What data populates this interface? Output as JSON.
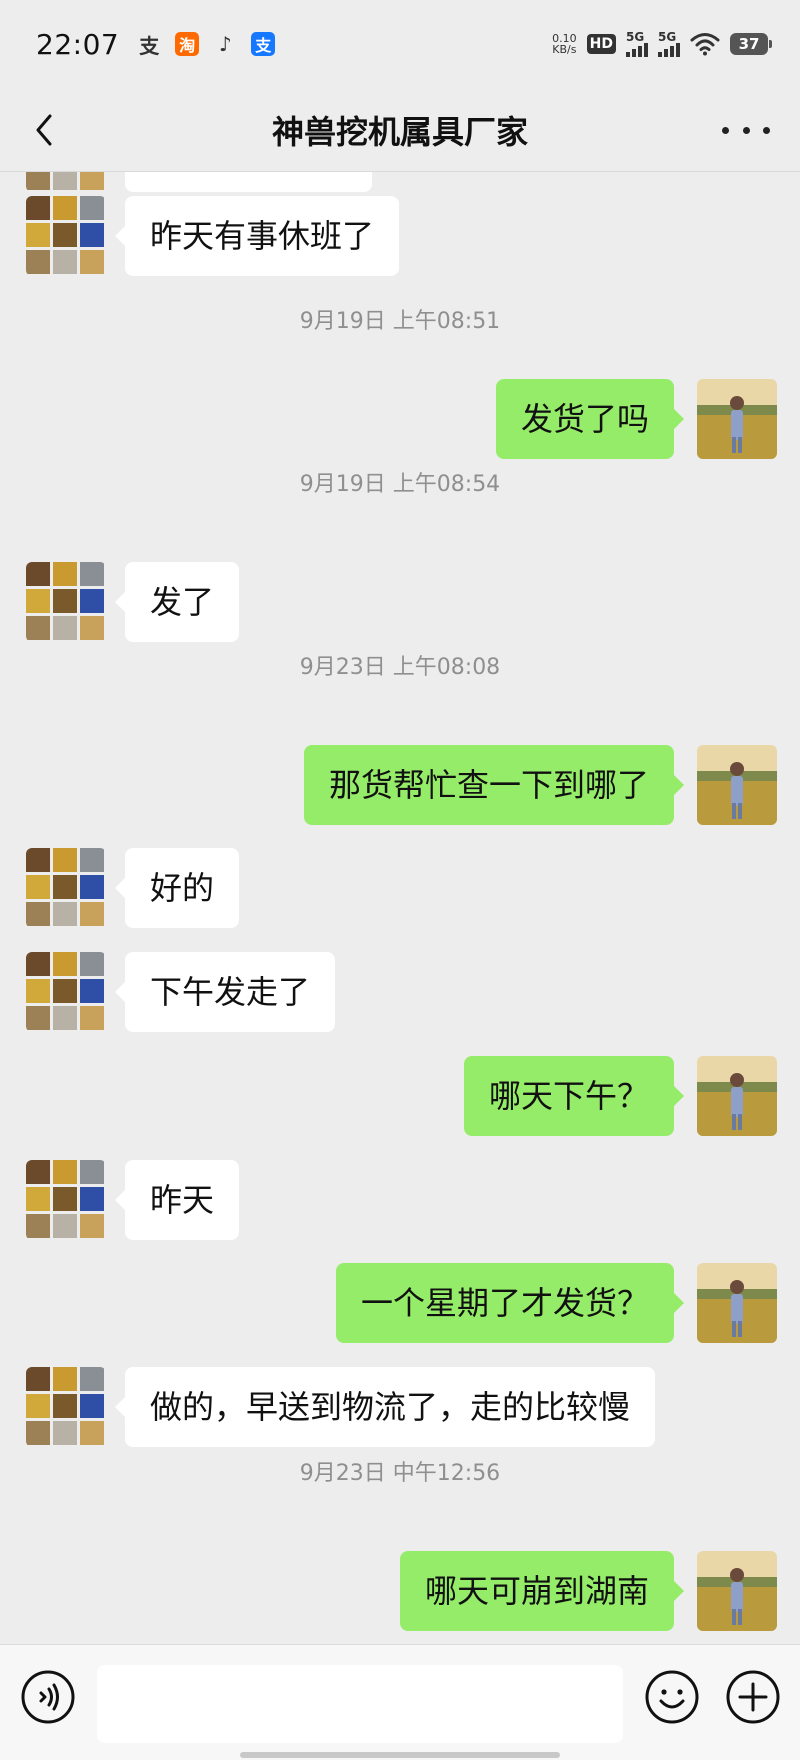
{
  "status_bar": {
    "time": "22:07",
    "net_speed_value": "0.10",
    "net_speed_unit": "KB/s",
    "hd_label": "HD",
    "signal1_label": "5G",
    "signal2_label": "5G",
    "battery": "37",
    "app_icons": [
      "alipay-icon",
      "taobao-icon",
      "tiktok-icon",
      "alipay-blue-icon"
    ],
    "app_glyphs": [
      "支",
      "淘",
      "♪",
      "支"
    ]
  },
  "nav": {
    "title": "神兽挖机属具厂家"
  },
  "messages": [
    {
      "type": "recv",
      "text": "昨天有事休班了"
    },
    {
      "type": "time",
      "text": "9月19日 上午08:51"
    },
    {
      "type": "sent",
      "text": "发货了吗"
    },
    {
      "type": "time",
      "text": "9月19日 上午08:54"
    },
    {
      "type": "recv",
      "text": "发了"
    },
    {
      "type": "time",
      "text": "9月23日 上午08:08"
    },
    {
      "type": "sent",
      "text": "那货帮忙查一下到哪了"
    },
    {
      "type": "recv",
      "text": "好的"
    },
    {
      "type": "recv",
      "text": "下午发走了"
    },
    {
      "type": "sent",
      "text": "哪天下午？"
    },
    {
      "type": "recv",
      "text": "昨天"
    },
    {
      "type": "sent",
      "text": "一个星期了才发货？"
    },
    {
      "type": "recv",
      "text": "做的，早送到物流了，走的比较慢"
    },
    {
      "type": "time",
      "text": "9月23日 中午12:56"
    },
    {
      "type": "sent",
      "text": "哪天可崩到湖南"
    }
  ],
  "input": {
    "value": "",
    "placeholder": ""
  },
  "colors": {
    "sent_bubble": "#95ec69",
    "recv_bubble": "#ffffff",
    "background": "#ededed",
    "timestamp": "#8f8f8f"
  }
}
